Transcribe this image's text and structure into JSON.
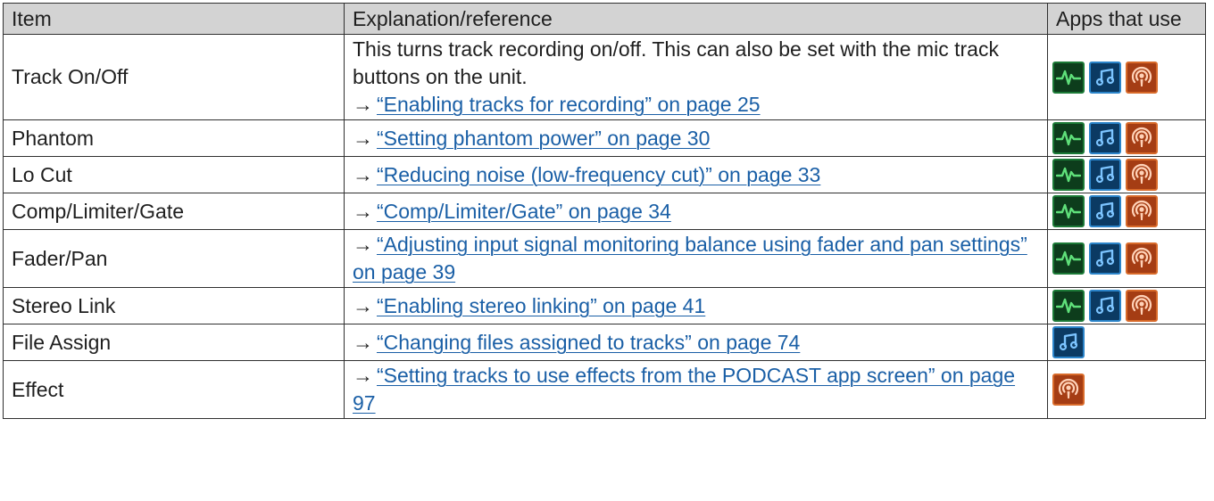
{
  "headers": {
    "item": "Item",
    "explanation": "Explanation/reference",
    "apps": "Apps that use"
  },
  "rows": [
    {
      "item": "Track On/Off",
      "text": "This turns track recording on/off. This can also be set with the mic track buttons on the unit.",
      "arrow": "→",
      "link": "“Enabling tracks for recording” on page 25",
      "apps": [
        "recorder-app-icon",
        "music-app-icon",
        "podcast-app-icon"
      ]
    },
    {
      "item": "Phantom",
      "arrow": "→",
      "link": "“Setting phantom power” on page 30",
      "apps": [
        "recorder-app-icon",
        "music-app-icon",
        "podcast-app-icon"
      ]
    },
    {
      "item": "Lo Cut",
      "arrow": "→",
      "link": "“Reducing noise (low-frequency cut)” on page 33",
      "apps": [
        "recorder-app-icon",
        "music-app-icon",
        "podcast-app-icon"
      ]
    },
    {
      "item": "Comp/Limiter/Gate",
      "arrow": "→",
      "link": "“Comp/Limiter/Gate” on page 34",
      "apps": [
        "recorder-app-icon",
        "music-app-icon",
        "podcast-app-icon"
      ]
    },
    {
      "item": "Fader/Pan",
      "arrow": "→",
      "link": "“Adjusting input signal monitoring balance using fader and pan settings” on page 39",
      "apps": [
        "recorder-app-icon",
        "music-app-icon",
        "podcast-app-icon"
      ]
    },
    {
      "item": "Stereo Link",
      "arrow": "→",
      "link": "“Enabling stereo linking” on page 41",
      "apps": [
        "recorder-app-icon",
        "music-app-icon",
        "podcast-app-icon"
      ]
    },
    {
      "item": "File Assign",
      "arrow": "→",
      "link": "“Changing files assigned to tracks” on page 74",
      "apps": [
        "music-app-icon"
      ]
    },
    {
      "item": "Effect",
      "arrow": "→",
      "link": "“Setting tracks to use effects from the PODCAST app screen” on page 97",
      "apps": [
        "podcast-app-icon"
      ]
    }
  ],
  "colors": {
    "header_bg": "#d3d3d3",
    "link": "#1a5fa6",
    "recorder_icon": "#1c7a37",
    "music_icon": "#2b84c9",
    "podcast_icon": "#a53d14"
  }
}
